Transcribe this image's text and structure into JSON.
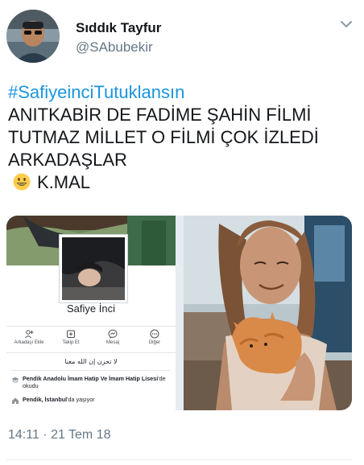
{
  "author": {
    "name": "Sıddık Tayfur",
    "handle": "@SAbubekir"
  },
  "tweet": {
    "hashtag": "#SafiyeinciTutuklansın",
    "line1": "ANITKABİR DE FADİME ŞAHİN FİLMİ",
    "line2": "TUTMAZ MİLLET O FİLMİ ÇOK İZLEDİ",
    "line3": "ARKADAŞLAR",
    "emoji": "smiling-face",
    "signature": "K.MAL",
    "timestamp": "14:11 · 21 Tem 18"
  },
  "colors": {
    "hashtag": "#1b95e0",
    "text": "#14171a",
    "muted": "#657786"
  },
  "profile_screenshot": {
    "name": "Safiye İnci",
    "actions": [
      {
        "label": "Arkadaşı Ekle",
        "icon": "add-friend-icon"
      },
      {
        "label": "Takip Et",
        "icon": "follow-icon"
      },
      {
        "label": "Mesaj",
        "icon": "messenger-icon"
      },
      {
        "label": "Diğer",
        "icon": "more-icon"
      }
    ],
    "arabic_text": "لا تحزن إن الله معنا",
    "education_bold": "Pendik Anadolu İmam Hatip Ve İmam Hatip Lisesi",
    "education_suffix": "'de okudu",
    "location_prefix": "Pendik, İstanbul",
    "location_suffix": "'da yaşıyor"
  }
}
